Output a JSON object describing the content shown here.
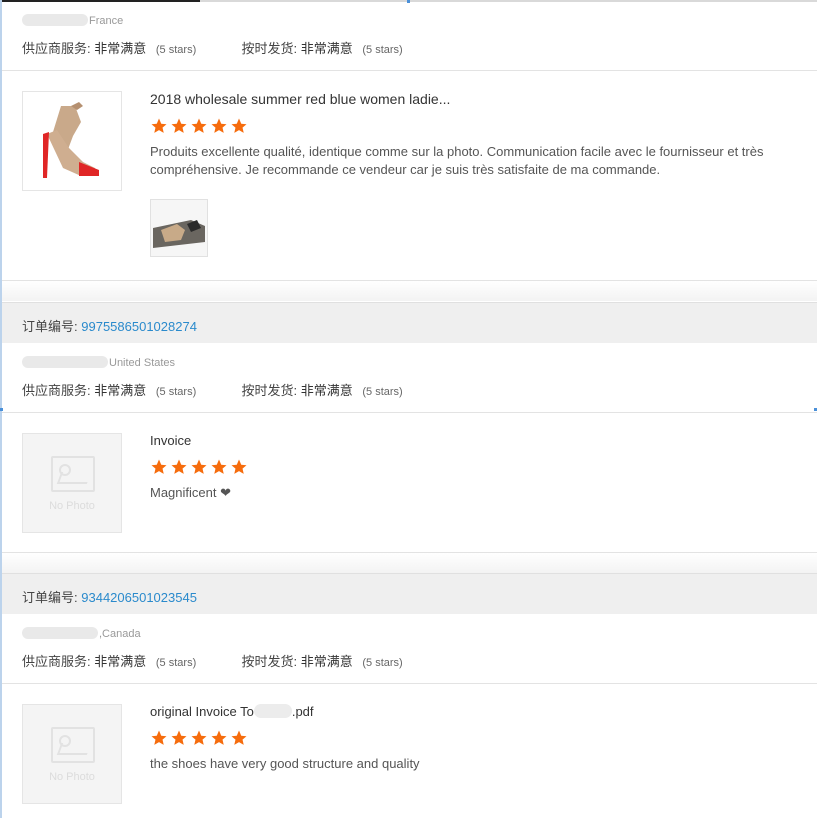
{
  "theme": {
    "star_color": "#f66c0d",
    "link_color": "#2a8acc"
  },
  "labels": {
    "supplier_service": "供应商服务:",
    "on_time": "按时发货:",
    "order_number": "订单编号:"
  },
  "reviews": [
    {
      "country": "France",
      "supplier_rating": "非常满意",
      "supplier_stars": "(5 stars)",
      "shipping_rating": "非常满意",
      "shipping_stars": "(5 stars)",
      "product_title": "2018 wholesale summer red blue women ladie...",
      "stars": 5,
      "review_text": "Produits excellente qualité, identique comme sur la photo. Communication facile avec le fournisseur et très compréhensive. Je recommande ce vendeur car je suis très satisfaite de ma commande.",
      "has_photo": true
    },
    {
      "order_number": "9975586501028274",
      "country": "United States",
      "supplier_rating": "非常满意",
      "supplier_stars": "(5 stars)",
      "shipping_rating": "非常满意",
      "shipping_stars": "(5 stars)",
      "product_title": "Invoice",
      "stars": 5,
      "review_text": "Magnificent ❤",
      "no_photo_text": "No Photo"
    },
    {
      "order_number": "9344206501023545",
      "country": ",Canada",
      "supplier_rating": "非常满意",
      "supplier_stars": "(5 stars)",
      "shipping_rating": "非常满意",
      "shipping_stars": "(5 stars)",
      "product_title_prefix": "original Invoice To",
      "product_title_suffix": ".pdf",
      "stars": 5,
      "review_text": "the shoes have very good structure and quality",
      "no_photo_text": "No Photo"
    }
  ]
}
